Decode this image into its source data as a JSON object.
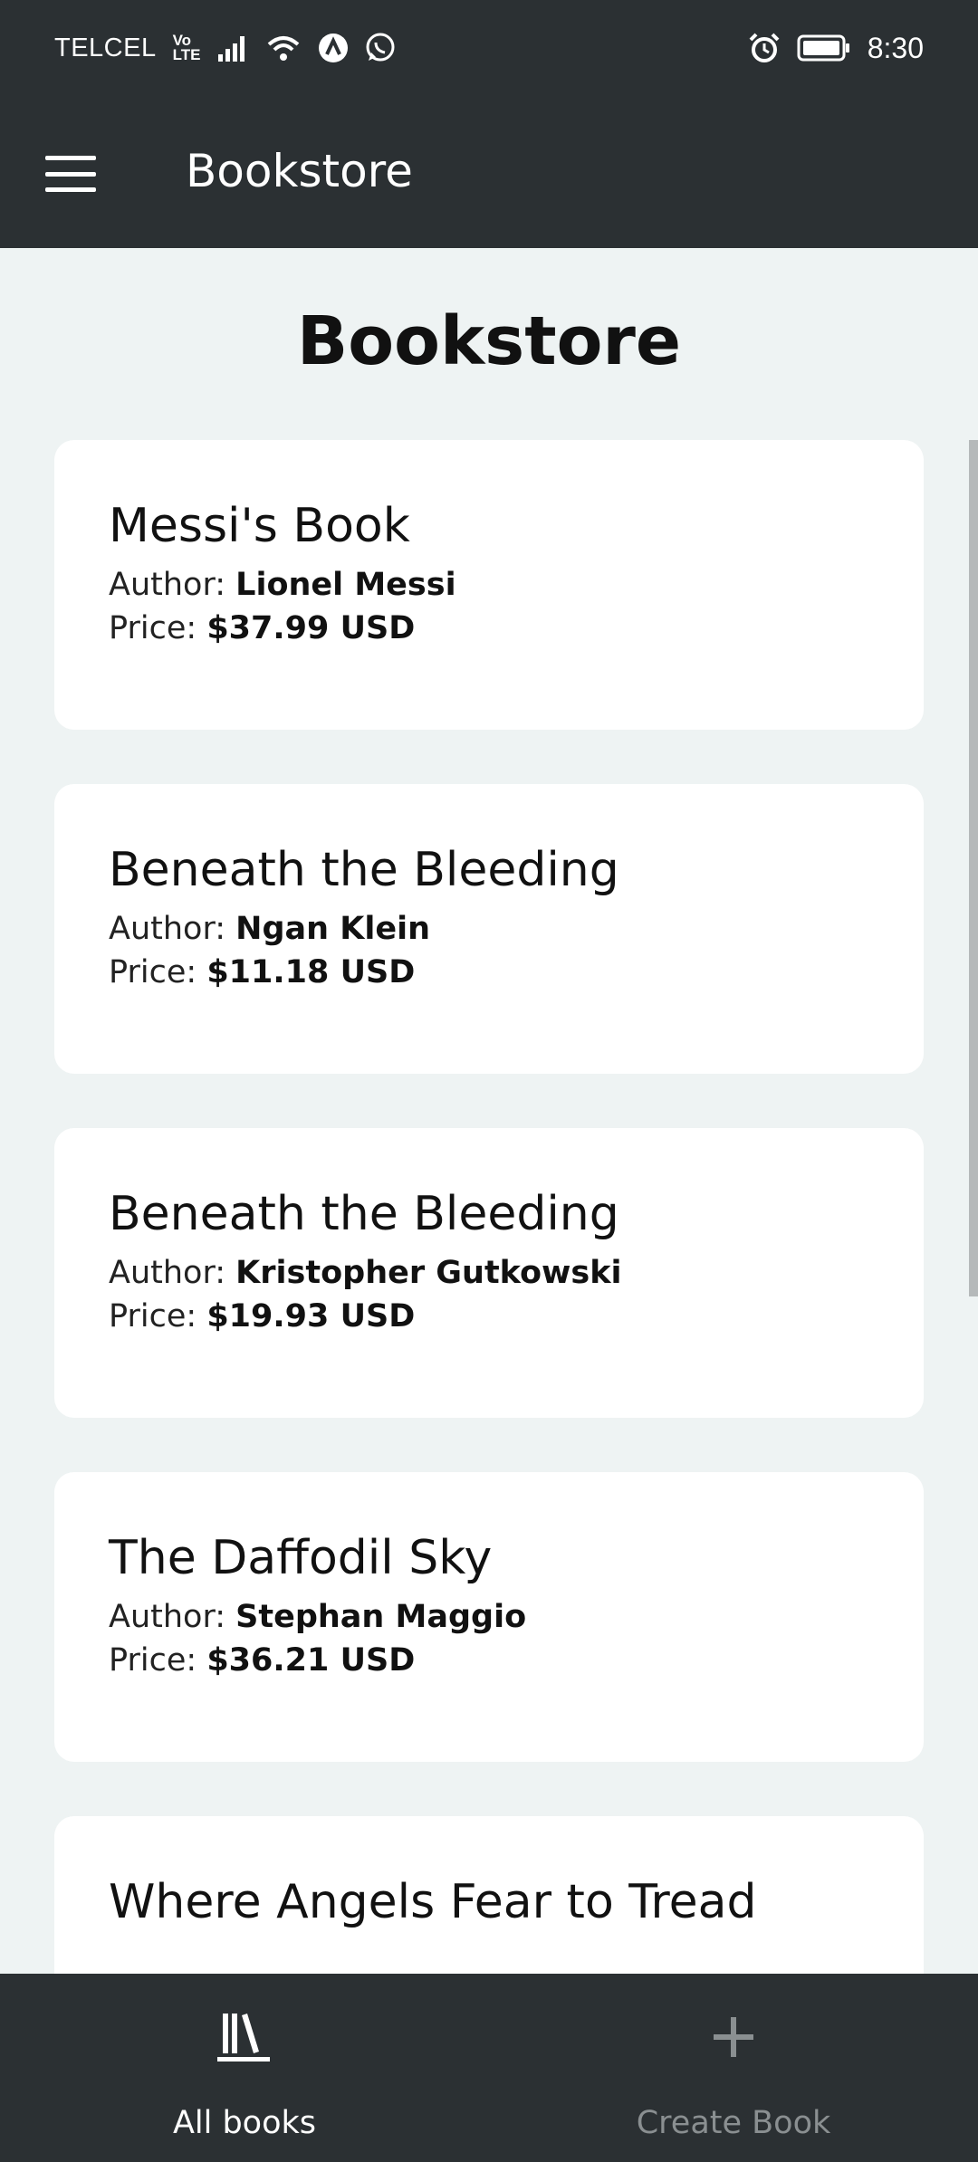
{
  "status_bar": {
    "carrier": "TELCEL",
    "volte_top": "Vo",
    "volte_bottom": "LTE",
    "time": "8:30"
  },
  "app_bar": {
    "title": "Bookstore",
    "menu_icon": "hamburger-menu-icon"
  },
  "page": {
    "title": "Bookstore"
  },
  "labels": {
    "author": "Author:",
    "price": "Price:"
  },
  "books": [
    {
      "title": "Messi's Book",
      "author": "Lionel Messi",
      "price": "$37.99 USD"
    },
    {
      "title": "Beneath the Bleeding",
      "author": "Ngan Klein",
      "price": "$11.18 USD"
    },
    {
      "title": "Beneath the Bleeding",
      "author": "Kristopher Gutkowski",
      "price": "$19.93 USD"
    },
    {
      "title": "The Daffodil Sky",
      "author": "Stephan Maggio",
      "price": "$36.21 USD"
    },
    {
      "title": "Where Angels Fear to Tread",
      "author": "",
      "price": ""
    }
  ],
  "bottom_nav": {
    "items": [
      {
        "label": "All books",
        "icon": "library-books-icon",
        "active": true
      },
      {
        "label": "Create Book",
        "icon": "plus-icon",
        "active": false
      }
    ]
  },
  "colors": {
    "app_bar": "#2b3033",
    "background": "#eef3f3",
    "card": "#ffffff",
    "inactive": "#8a8f91"
  }
}
